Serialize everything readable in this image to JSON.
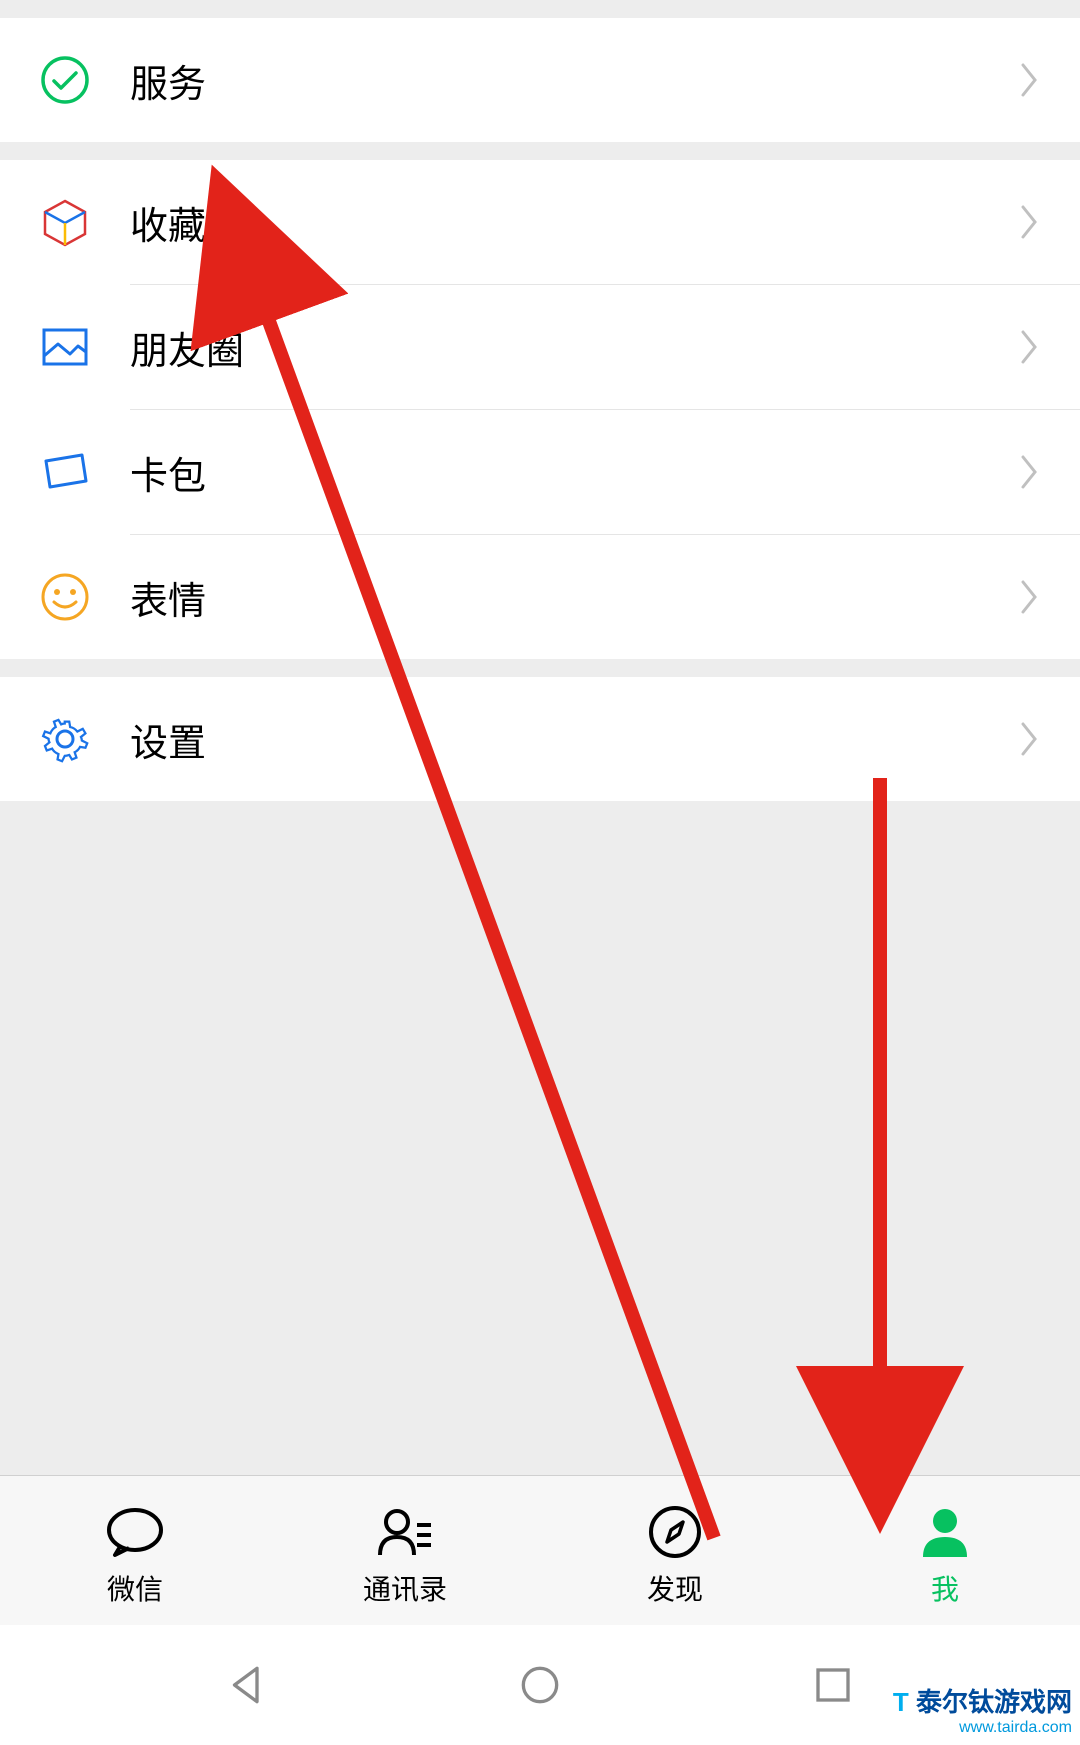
{
  "menu": {
    "services": {
      "label": "服务"
    },
    "favorites": {
      "label": "收藏"
    },
    "moments": {
      "label": "朋友圈"
    },
    "cards": {
      "label": "卡包"
    },
    "stickers": {
      "label": "表情"
    },
    "settings": {
      "label": "设置"
    }
  },
  "tabs": {
    "wechat": {
      "label": "微信"
    },
    "contacts": {
      "label": "通讯录"
    },
    "discover": {
      "label": "发现"
    },
    "me": {
      "label": "我"
    }
  },
  "watermark": {
    "text": "泰尔钛游戏网",
    "url": "www.tairda.com"
  }
}
